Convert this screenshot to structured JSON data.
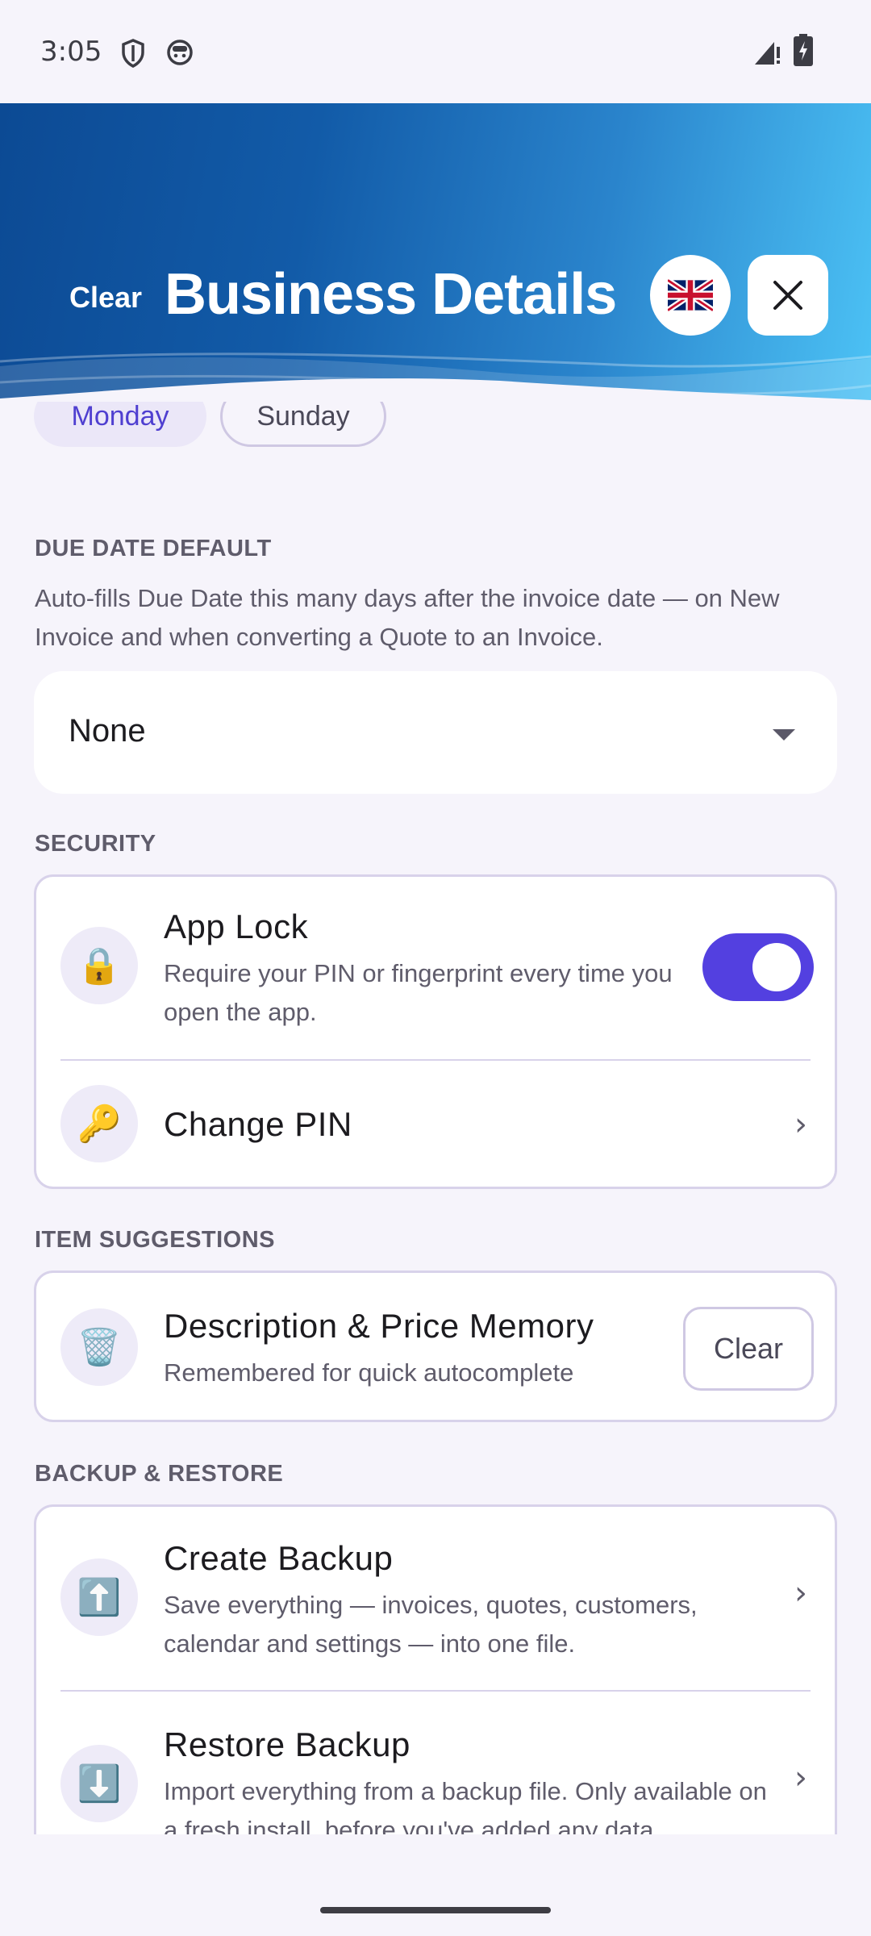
{
  "status_bar": {
    "time": "3:05"
  },
  "header": {
    "clear_label": "Clear",
    "title": "Business Details",
    "language_flag": "🇬🇧"
  },
  "week_start": {
    "options": [
      "Monday",
      "Sunday"
    ],
    "selected": "Monday"
  },
  "due_date": {
    "label": "DUE DATE DEFAULT",
    "description": "Auto-fills Due Date this many days after the invoice date — on New Invoice and when converting a Quote to an Invoice.",
    "value": "None"
  },
  "security": {
    "label": "SECURITY",
    "app_lock": {
      "icon": "🔒",
      "title": "App Lock",
      "subtitle": "Require your PIN or fingerprint every time you open the app.",
      "enabled": true
    },
    "change_pin": {
      "icon": "🔑",
      "title": "Change PIN"
    }
  },
  "item_suggestions": {
    "label": "ITEM SUGGESTIONS",
    "memory": {
      "icon": "🗑️",
      "title": "Description & Price Memory",
      "subtitle": "Remembered for quick autocomplete",
      "button_label": "Clear"
    }
  },
  "backup": {
    "label": "BACKUP & RESTORE",
    "create": {
      "icon": "⬆️",
      "title": "Create Backup",
      "subtitle": "Save everything — invoices, quotes, customers, calendar and settings — into one file."
    },
    "restore": {
      "icon": "⬇️",
      "title": "Restore Backup",
      "subtitle": "Import everything from a backup file. Only available on a fresh install, before you've added any data."
    }
  },
  "colors": {
    "accent": "#5340e0",
    "header_start": "#0c4a94",
    "header_end": "#4cc2f5"
  },
  "icons": {
    "close": "close-icon",
    "chevron": "chevron-right-icon",
    "dropdown": "dropdown-arrow-icon"
  }
}
